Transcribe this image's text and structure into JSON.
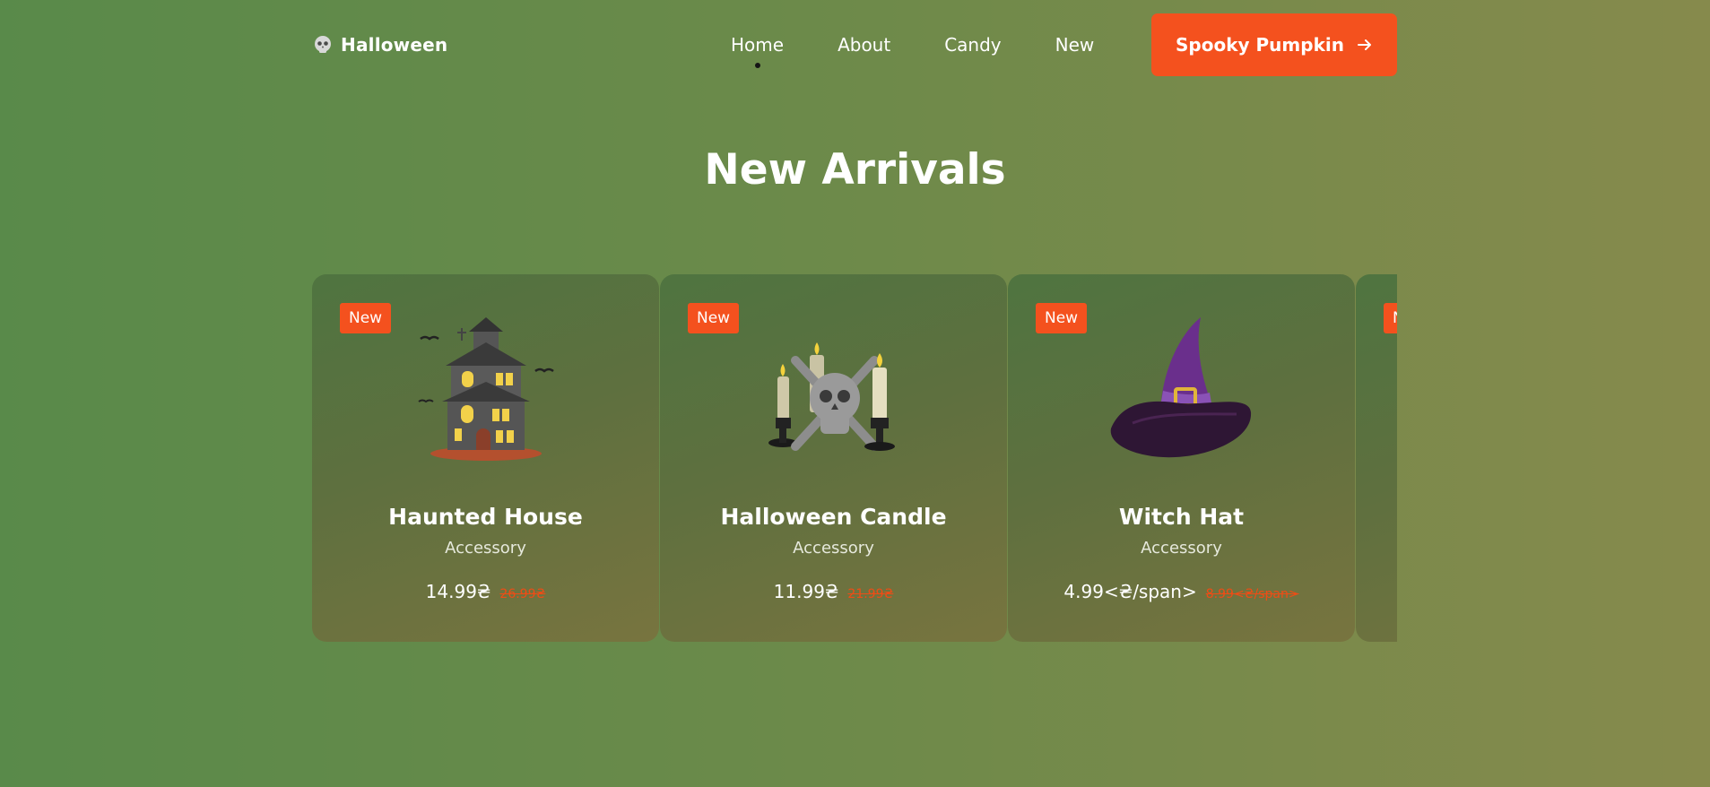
{
  "brand": {
    "name": "Halloween",
    "logo_icon": "skull-icon"
  },
  "nav": {
    "items": [
      "Home",
      "About",
      "Candy",
      "New"
    ],
    "active": "Home"
  },
  "cta": {
    "label": "Spooky Pumpkin",
    "icon": "arrow-right-icon"
  },
  "section": {
    "title": "New Arrivals"
  },
  "products": [
    {
      "badge": "New",
      "name": "Haunted House",
      "category": "Accessory",
      "price": "14.99₴",
      "old_price": "26.99₴",
      "icon": "haunted-house-icon"
    },
    {
      "badge": "New",
      "name": "Halloween Candle",
      "category": "Accessory",
      "price": "11.99₴",
      "old_price": "21.99₴",
      "icon": "candle-skull-icon"
    },
    {
      "badge": "New",
      "name": "Witch Hat",
      "category": "Accessory",
      "price": "4.99<₴/span>",
      "old_price": "8.99<₴/span>",
      "icon": "witch-hat-icon"
    },
    {
      "badge": "New"
    }
  ],
  "colors": {
    "accent": "#f4511e",
    "background_start": "#598a4a",
    "background_end": "#868a4c",
    "card": "#5e703f"
  }
}
